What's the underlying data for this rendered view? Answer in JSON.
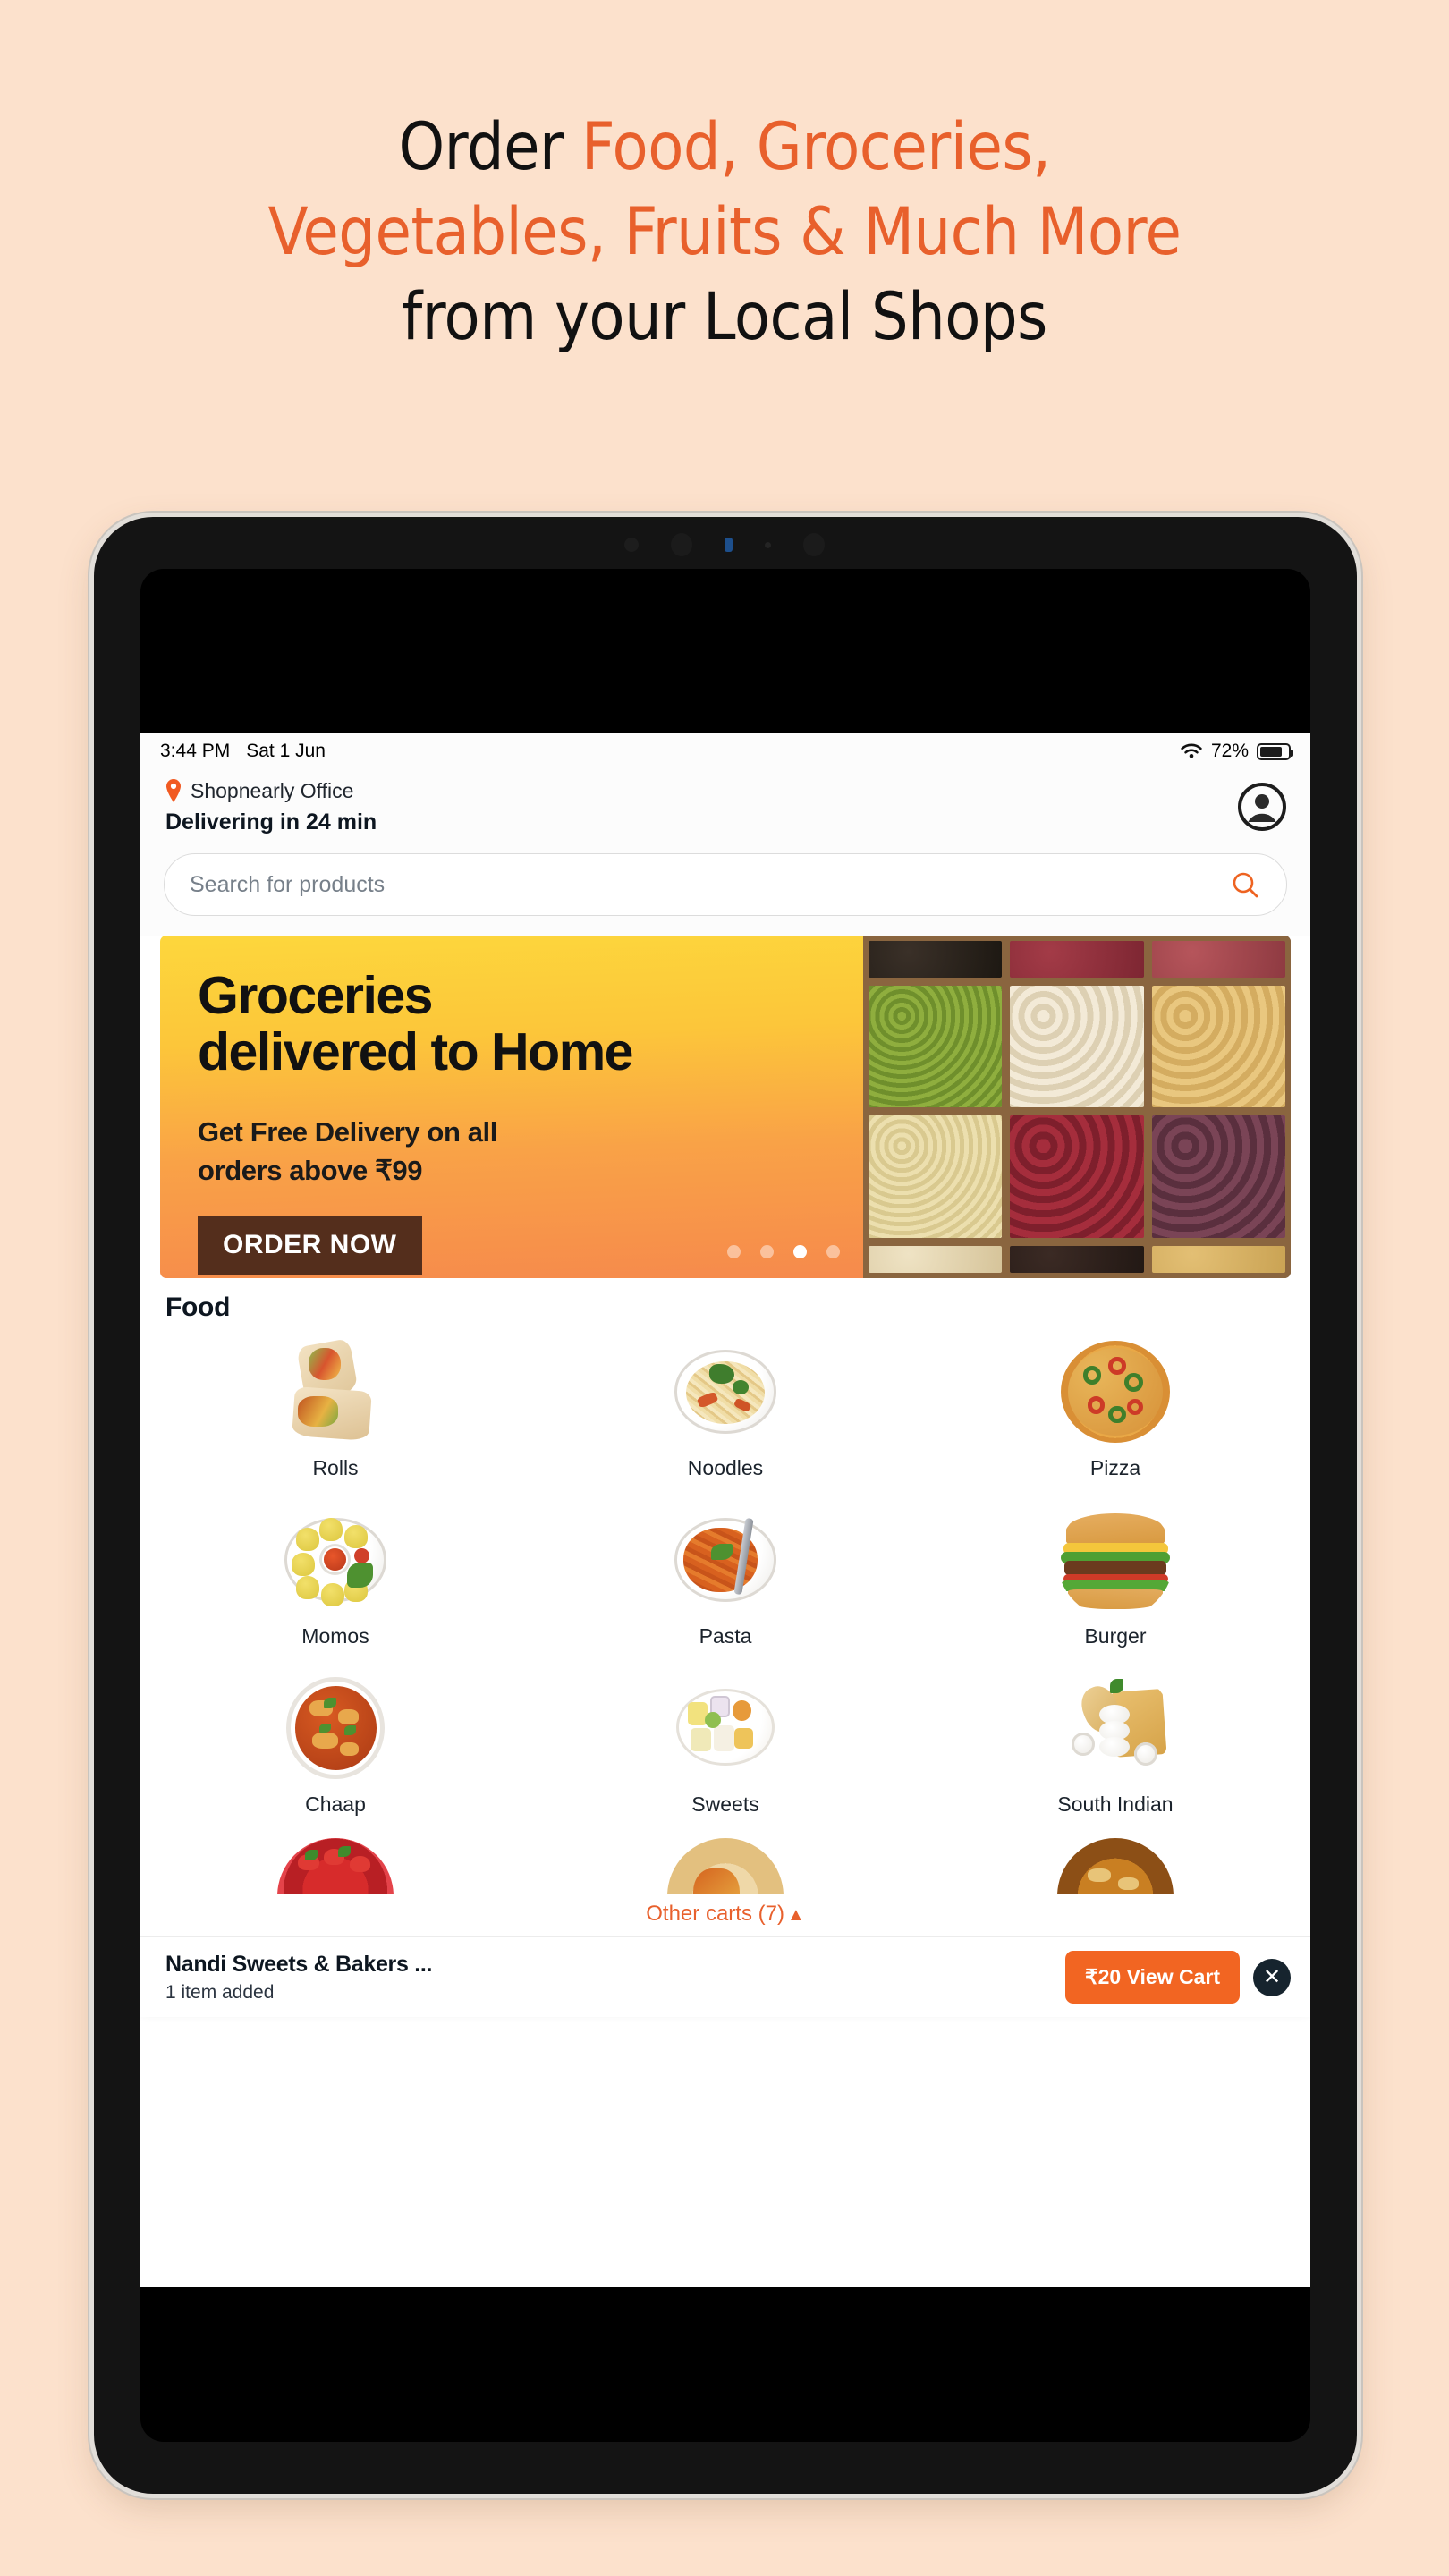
{
  "headline": {
    "line1_plain": "Order ",
    "line1_accent": "Food, Groceries,",
    "line2_accent": "Vegetables, Fruits & Much More",
    "line3_plain": "from your Local Shops",
    "plain_color": "#111111",
    "accent_color": "#E8602C",
    "page_background": "#FCE1CC"
  },
  "status_bar": {
    "time": "3:44 PM",
    "date": "Sat 1 Jun",
    "wifi_icon": "wifi-icon",
    "battery_percent": "72%",
    "battery_level": 72
  },
  "header": {
    "location_pin_icon": "location-pin-icon",
    "location_name": "Shopnearly Office",
    "delivery_eta": "Delivering in 24 min",
    "profile_icon": "account-circle-icon"
  },
  "search": {
    "placeholder": "Search for products",
    "icon": "search-icon",
    "value": ""
  },
  "banner": {
    "title_line1": "Groceries",
    "title_line2": "delivered to Home",
    "subtitle_line1": "Get Free Delivery on all",
    "subtitle_line2": "orders above ₹99",
    "cta_label": "ORDER NOW",
    "cta_background": "#542E1C",
    "gradient_from": "#FDD73C",
    "gradient_to": "#F68A4C",
    "dots_total": 4,
    "dots_active_index": 2,
    "image_alt": "assorted-beans-in-wooden-tray"
  },
  "food_section": {
    "title": "Food",
    "categories": [
      {
        "label": "Rolls",
        "art": "rolls"
      },
      {
        "label": "Noodles",
        "art": "noodles"
      },
      {
        "label": "Pizza",
        "art": "pizza"
      },
      {
        "label": "Momos",
        "art": "momos"
      },
      {
        "label": "Pasta",
        "art": "pasta"
      },
      {
        "label": "Burger",
        "art": "burger"
      },
      {
        "label": "Chaap",
        "art": "chaap"
      },
      {
        "label": "Sweets",
        "art": "sweets"
      },
      {
        "label": "South Indian",
        "art": "southindian"
      }
    ],
    "partial_row_alt": [
      "strawberry-cake",
      "shawarma",
      "biryani"
    ]
  },
  "other_carts": {
    "label": "Other carts (7)",
    "caret_icon": "caret-up-icon",
    "color": "#E8602C"
  },
  "cart_bar": {
    "store_name": "Nandi Sweets & Bakers ...",
    "items_text": "1 item added",
    "view_cart_label": "₹20 View Cart",
    "view_cart_color": "#F26522",
    "close_icon": "close-icon"
  }
}
